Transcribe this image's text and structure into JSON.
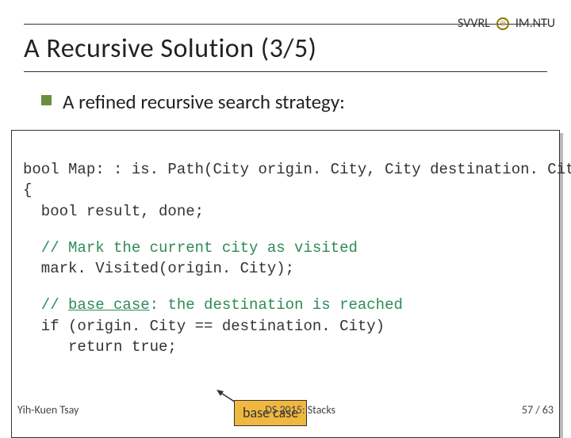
{
  "header": {
    "lab": "SVVRL",
    "at": "@",
    "dept": "IM.NTU"
  },
  "title": "A Recursive Solution (3/5)",
  "bullet": "A refined recursive search strategy:",
  "code": {
    "line1": "bool Map: : is. Path(City origin. City, City destination. City)",
    "line2": "{",
    "line3": "  bool result, done;",
    "comment1": "  // Mark the current city as visited",
    "line4": "  mark. Visited(origin. City);",
    "comment2_a": "  // ",
    "comment2_underline": "base case",
    "comment2_b": ": the destination is reached",
    "line5": "  if (origin. City == destination. City)",
    "line6": "     return true;"
  },
  "callout": "base case",
  "footer": {
    "left": "Yih-Kuen Tsay",
    "center": "DS 2015: Stacks",
    "right": "57 / 63"
  }
}
